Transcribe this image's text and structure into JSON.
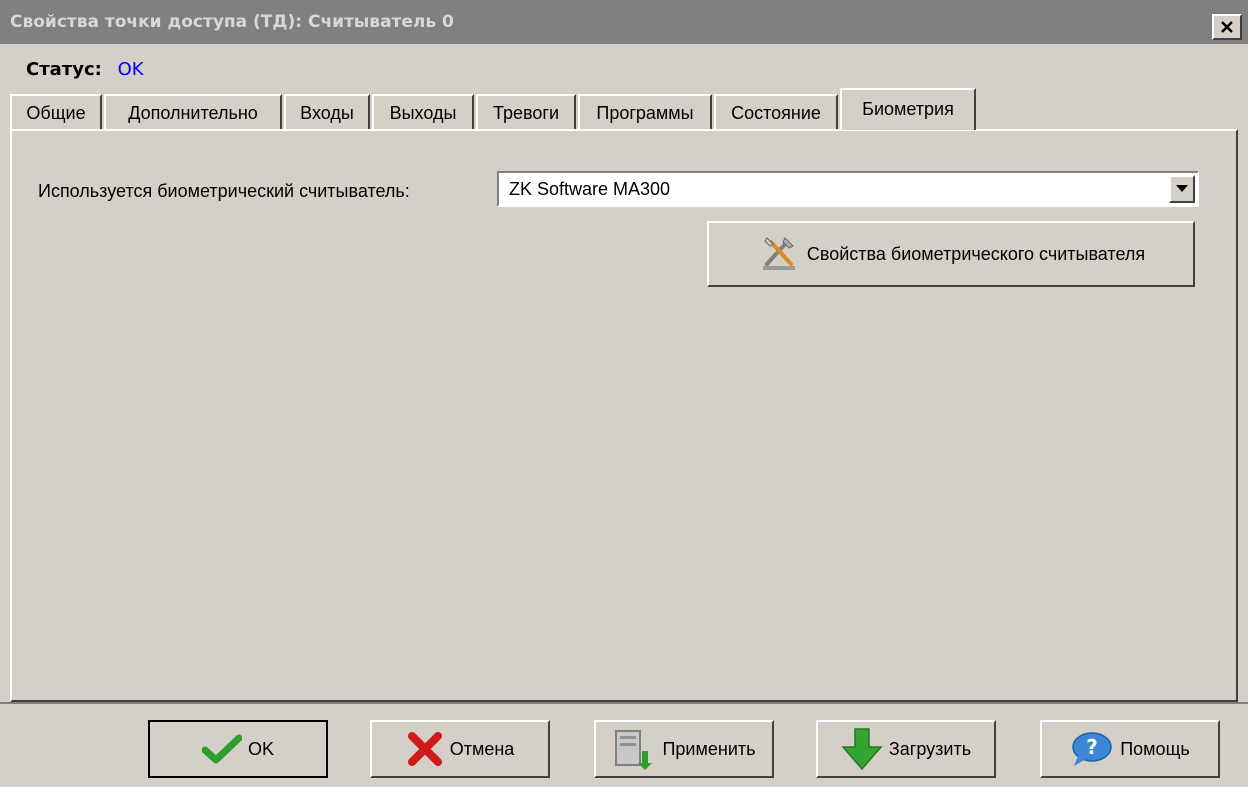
{
  "window": {
    "title": "Свойства точки доступа (ТД): Считыватель 0",
    "close_glyph": "✕"
  },
  "status": {
    "label": "Статус:",
    "value": "OK",
    "value_color": "#0000ff"
  },
  "tabs": [
    {
      "label": "Общие"
    },
    {
      "label": "Дополнительно"
    },
    {
      "label": "Входы"
    },
    {
      "label": "Выходы"
    },
    {
      "label": "Тревоги"
    },
    {
      "label": "Программы"
    },
    {
      "label": "Состояние"
    },
    {
      "label": "Биометрия",
      "active": true
    }
  ],
  "biometry": {
    "field_label": "Используется биометрический считыватель:",
    "selected_reader": "ZK Software MA300",
    "properties_button": "Свойства биометрического считывателя",
    "properties_icon": "tools-icon"
  },
  "footer": {
    "ok_label": "OK",
    "ok_icon": "checkmark-icon",
    "cancel_label": "Отмена",
    "cancel_icon": "red-x-icon",
    "apply_label": "Применить",
    "apply_icon": "server-arrow-icon",
    "load_label": "Загрузить",
    "load_icon": "green-down-arrow-icon",
    "help_label": "Помощь",
    "help_icon": "help-bubble-icon"
  },
  "colors": {
    "window_bg": "#d4d0c8",
    "titlebar_bg": "#808080",
    "accent_blue": "#0000ff"
  }
}
